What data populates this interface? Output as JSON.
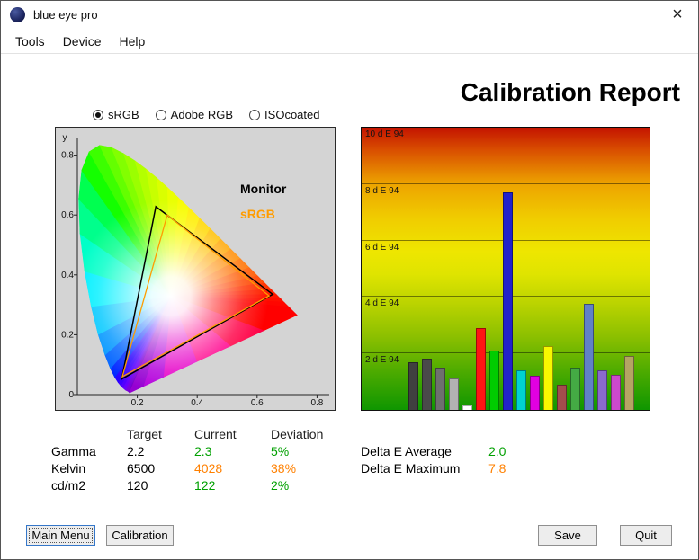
{
  "window": {
    "title": "blue eye pro",
    "icon_name": "blue-sphere-icon",
    "close_glyph": "×"
  },
  "menu": {
    "items": [
      {
        "label": "Tools"
      },
      {
        "label": "Device"
      },
      {
        "label": "Help"
      }
    ]
  },
  "report_title": "Calibration Report",
  "gamut_selector": {
    "options": [
      {
        "label": "sRGB",
        "selected": true
      },
      {
        "label": "Adobe RGB",
        "selected": false
      },
      {
        "label": "ISOcoated",
        "selected": false
      }
    ]
  },
  "cie_legend": {
    "monitor": "Monitor",
    "monitor_color": "#000000",
    "srgb": "sRGB",
    "srgb_color": "#ff9c00"
  },
  "results_table": {
    "headers": [
      "Target",
      "Current",
      "Deviation"
    ],
    "rows": [
      {
        "label": "Gamma",
        "target": "2.2",
        "current": "2.3",
        "deviation": "5%",
        "status_color": "#00a000"
      },
      {
        "label": "Kelvin",
        "target": "6500",
        "current": "4028",
        "deviation": "38%",
        "status_color": "#ff8000"
      },
      {
        "label": "cd/m2",
        "target": "120",
        "current": "122",
        "deviation": "2%",
        "status_color": "#00a000"
      }
    ]
  },
  "delta_e": {
    "average_label": "Delta E Average",
    "average": "2.0",
    "average_color": "#00a000",
    "maximum_label": "Delta E Maximum",
    "maximum": "7.8",
    "maximum_color": "#ff8000"
  },
  "buttons": {
    "main_menu": "Main Menu",
    "calibration": "Calibration",
    "save": "Save",
    "quit": "Quit"
  },
  "chart_data": [
    {
      "type": "scatter",
      "title": "CIE 1931 xy chromaticity diagram with device gamut triangles",
      "y_axis_title": "y",
      "xlim": [
        0,
        0.85
      ],
      "ylim": [
        0,
        0.9
      ],
      "x_ticks": {
        "values": [
          0.2,
          0.4,
          0.6,
          0.8
        ],
        "labels": [
          "0.2",
          "0.4",
          "0.6",
          "0.8"
        ]
      },
      "y_ticks": {
        "values": [
          0.8,
          0.6,
          0.4,
          0.2,
          0
        ],
        "labels": [
          "0.8",
          "0.6",
          "0.4",
          "0.2",
          "0"
        ]
      },
      "series": [
        {
          "name": "Monitor",
          "color": "#000000",
          "points": [
            [
              0.652,
              0.335
            ],
            [
              0.262,
              0.628
            ],
            [
              0.148,
              0.052
            ]
          ]
        },
        {
          "name": "sRGB",
          "color": "#ff9c00",
          "points": [
            [
              0.64,
              0.33
            ],
            [
              0.3,
              0.6
            ],
            [
              0.15,
              0.06
            ]
          ]
        }
      ]
    },
    {
      "type": "bar",
      "title": "Delta E 94 per measured patch",
      "ylabel": "dE94",
      "ylim": [
        0,
        10
      ],
      "gridline_values": [
        2,
        4,
        6,
        8,
        10
      ],
      "gridline_labels": [
        "2 d E 94",
        "4 d E 94",
        "6 d E 94",
        "8 d E 94",
        "10 d E 94"
      ],
      "values": [
        1.7,
        1.8,
        1.5,
        1.1,
        0.15,
        2.9,
        2.1,
        7.7,
        1.4,
        1.2,
        2.25,
        0.9,
        1.5,
        3.75,
        1.4,
        1.25,
        1.9
      ],
      "colors": [
        "#404040",
        "#4a4a4a",
        "#6f6f6f",
        "#b2b2b2",
        "#ffffff",
        "#ff1414",
        "#00cc00",
        "#2222cc",
        "#00d2d2",
        "#e000e0",
        "#f8f800",
        "#a34d4d",
        "#44aa44",
        "#6181c8",
        "#8a6ace",
        "#cc49cc",
        "#b5a464"
      ]
    }
  ]
}
